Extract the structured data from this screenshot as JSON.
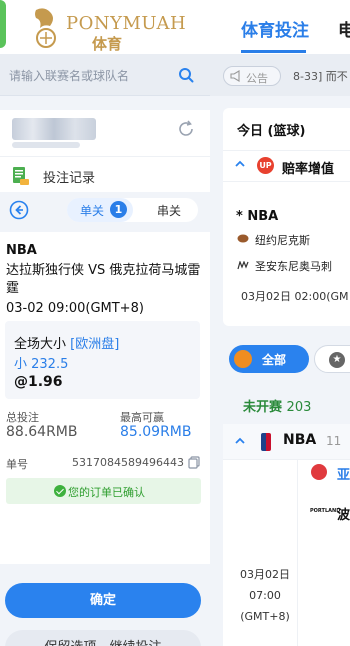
{
  "header": {
    "brand": "PONYMUAH",
    "brand_sub": "体育",
    "nav_active": "体育投注",
    "nav_next": "电"
  },
  "search": {
    "placeholder": "请输入联赛名或球队名"
  },
  "account": {
    "bet_record_label": "投注记录"
  },
  "betslip": {
    "tab_single": "单关",
    "tab_single_count": "1",
    "tab_multi": "串关",
    "league": "NBA",
    "match": "达拉斯独行侠 VS 俄克拉荷马城雷霆",
    "time": "03-02 09:00(GMT+8)",
    "market": "全场大小",
    "market_tag": "[欧洲盘]",
    "pick": "小 232.5",
    "odds": "@1.96",
    "stake_label": "总投注",
    "stake_value": "88.64RMB",
    "win_label": "最高可赢",
    "win_value": "85.09RMB",
    "order_label": "单号",
    "order_value": "5317084589496443",
    "confirmed_text": "您的订单已确认",
    "confirm_button": "确定",
    "keep_button": "保留选项，继续投注"
  },
  "notice": {
    "label": "公告",
    "text": "8-33] 而不"
  },
  "today": {
    "title": "今日 (篮球)",
    "section": "赔率增值",
    "section_badge": "UP",
    "league": "* NBA",
    "team1": "纽约尼克斯",
    "team2": "圣安东尼奥马刺",
    "time": "03月02日 02:00(GM"
  },
  "filters": {
    "all": "全部"
  },
  "upcoming": {
    "label": "未开赛",
    "count": "203"
  },
  "league_block": {
    "label": "NBA",
    "count": "11",
    "time_line1": "03月02日",
    "time_line2": "07:00",
    "time_line3": "(GMT+8)",
    "team_a": "亚",
    "team_b": "波",
    "team_b_logo_text": "PORTLAND"
  },
  "colors": {
    "accent": "#2a82ee",
    "brand_gold": "#c59a4e",
    "success": "#3eb13e"
  }
}
